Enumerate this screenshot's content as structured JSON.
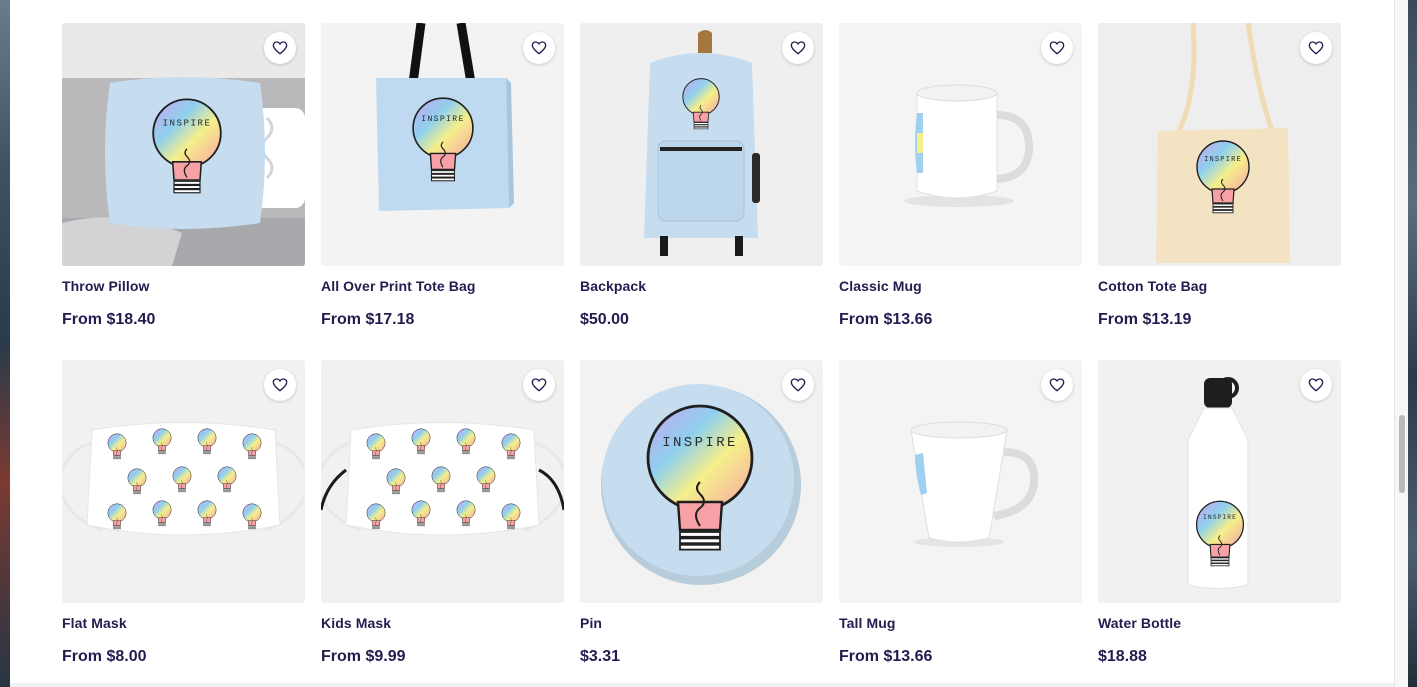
{
  "products": [
    {
      "title": "Throw Pillow",
      "price": "From $18.40",
      "kind": "pillow",
      "bg": "#c9c9cb",
      "icon": "heart-icon"
    },
    {
      "title": "All Over Print Tote Bag",
      "price": "From $17.18",
      "kind": "tote",
      "bg": "#f3f3f3",
      "icon": "heart-icon"
    },
    {
      "title": "Backpack",
      "price": "$50.00",
      "kind": "backpack",
      "bg": "#efefef",
      "icon": "heart-icon"
    },
    {
      "title": "Classic Mug",
      "price": "From $13.66",
      "kind": "mug",
      "bg": "#f4f4f4",
      "icon": "heart-icon"
    },
    {
      "title": "Cotton Tote Bag",
      "price": "From $13.19",
      "kind": "cotton",
      "bg": "#eeeeee",
      "icon": "heart-icon"
    },
    {
      "title": "Flat Mask",
      "price": "From $8.00",
      "kind": "mask",
      "bg": "#f1f1f1",
      "icon": "heart-icon"
    },
    {
      "title": "Kids Mask",
      "price": "From $9.99",
      "kind": "kidsmask",
      "bg": "#f1f1f1",
      "icon": "heart-icon"
    },
    {
      "title": "Pin",
      "price": "$3.31",
      "kind": "pin",
      "bg": "#f2f2f2",
      "icon": "heart-icon"
    },
    {
      "title": "Tall Mug",
      "price": "From $13.66",
      "kind": "tallmug",
      "bg": "#f4f4f4",
      "icon": "heart-icon"
    },
    {
      "title": "Water Bottle",
      "price": "$18.88",
      "kind": "bottle",
      "bg": "#f1f1f1",
      "icon": "heart-icon"
    }
  ],
  "design_text": "INSPIRE",
  "colors": {
    "text": "#221d4f",
    "light_blue": "#c6ddf0",
    "card_bg": "#f4f4f4"
  }
}
